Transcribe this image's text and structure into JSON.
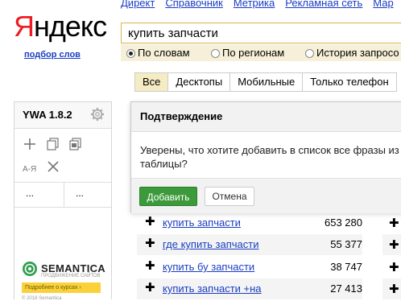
{
  "top_nav": [
    "Директ",
    "Справочник",
    "Метрика",
    "Рекламная сеть",
    "Мар"
  ],
  "logo": {
    "first": "Я",
    "rest": "ндекс"
  },
  "podbor_link": "подбор слов",
  "search": {
    "value": "купить запчасти"
  },
  "radio_options": [
    {
      "label": "По словам",
      "selected": true
    },
    {
      "label": "По регионам",
      "selected": false
    },
    {
      "label": "История запросо",
      "selected": false
    }
  ],
  "device_tabs": [
    {
      "label": "Все",
      "active": true
    },
    {
      "label": "Десктопы",
      "active": false
    },
    {
      "label": "Мобильные",
      "active": false
    },
    {
      "label": "Только телефон",
      "active": false
    }
  ],
  "ywa": {
    "title": "YWA 1.8.2",
    "col_left": "...",
    "col_right": "..."
  },
  "dialog": {
    "title": "Подтверждение",
    "message": "Уверены, что хотите добавить в список все фразы из таблицы?",
    "confirm_label": "Добавить",
    "cancel_label": "Отмена"
  },
  "keywords": [
    {
      "phrase": "купить запчасти",
      "count": "653 280"
    },
    {
      "phrase": "где купить запчасти",
      "count": "55 377"
    },
    {
      "phrase": "купить бу запчасти",
      "count": "38 747"
    },
    {
      "phrase": "купить запчасти +на",
      "count": "27 413"
    }
  ],
  "plus_symbol": "✚",
  "semantica": {
    "name": "SEMANTICA",
    "sub": "ПРОДВИЖЕНИЕ САЙТОВ",
    "button": "Подробнее о курсах ›",
    "footer": "© 2018 Semantica"
  },
  "colors": {
    "yandex_red": "#ee1d24",
    "link": "#1a3dc1",
    "confirm_green": "#3c9a3b",
    "tab_active": "#f6ecc3"
  }
}
